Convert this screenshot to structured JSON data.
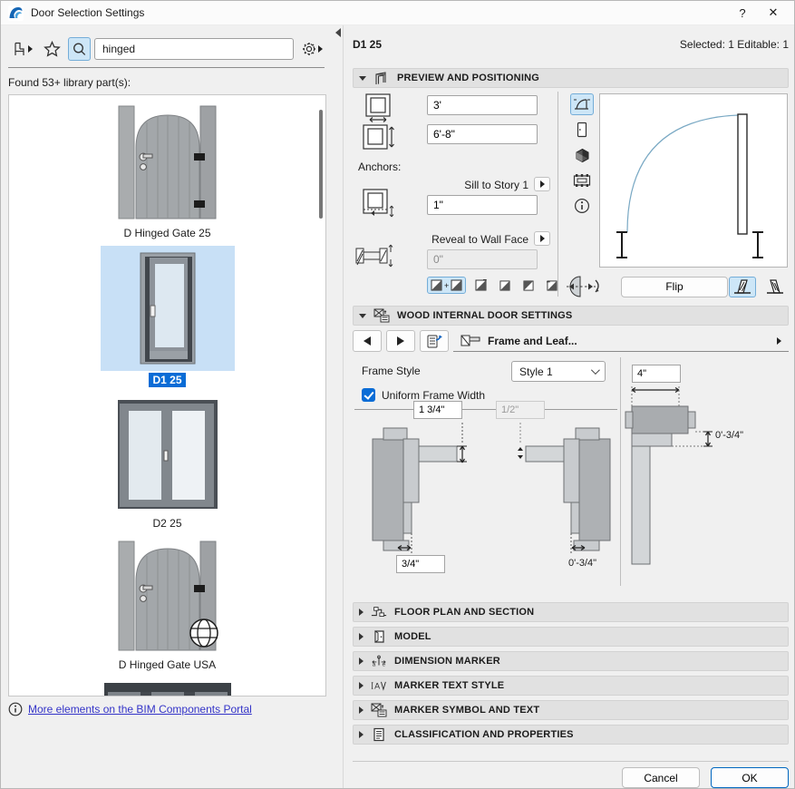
{
  "window": {
    "title": "Door Selection Settings",
    "help": "?",
    "close": "✕"
  },
  "search": {
    "value": "hinged",
    "results_text": "Found 53+ library part(s):"
  },
  "library": {
    "items": [
      {
        "label": "D Hinged Gate 25"
      },
      {
        "label": "D1 25"
      },
      {
        "label": "D2 25"
      },
      {
        "label": "D Hinged Gate USA"
      }
    ],
    "link_text": "More elements on the BIM Components Portal"
  },
  "header": {
    "name": "D1 25",
    "status": "Selected: 1 Editable: 1"
  },
  "preview": {
    "section_title": "PREVIEW AND POSITIONING",
    "width_value": "3'",
    "height_value": "6'-8\"",
    "anchors_label": "Anchors:",
    "sill_label": "Sill to Story 1",
    "sill_value": "1\"",
    "reveal_label": "Reveal to Wall Face",
    "reveal_value": "0\"",
    "flip_label": "Flip"
  },
  "wood": {
    "section_title": "WOOD INTERNAL DOOR SETTINGS",
    "tab_label": "Frame and Leaf...",
    "frame_style_label": "Frame Style",
    "frame_style_value": "Style 1",
    "uniform_label": "Uniform Frame Width",
    "dims": {
      "leaf_thickness": "1 3/4\"",
      "rebate": "1/2\"",
      "frame_width": "3/4\"",
      "frame_width_right": "0'-3/4\"",
      "head_width": "4\"",
      "head_offset": "0'-3/4\""
    }
  },
  "sections": [
    {
      "label": "FLOOR PLAN AND SECTION"
    },
    {
      "label": "MODEL"
    },
    {
      "label": "DIMENSION MARKER"
    },
    {
      "label": "MARKER TEXT STYLE"
    },
    {
      "label": "MARKER SYMBOL AND TEXT"
    },
    {
      "label": "CLASSIFICATION AND PROPERTIES"
    }
  ],
  "footer": {
    "cancel": "Cancel",
    "ok": "OK"
  },
  "colors": {
    "accent": "#0a6cd6",
    "highlight": "#cde6f7",
    "link": "#3434c8"
  }
}
